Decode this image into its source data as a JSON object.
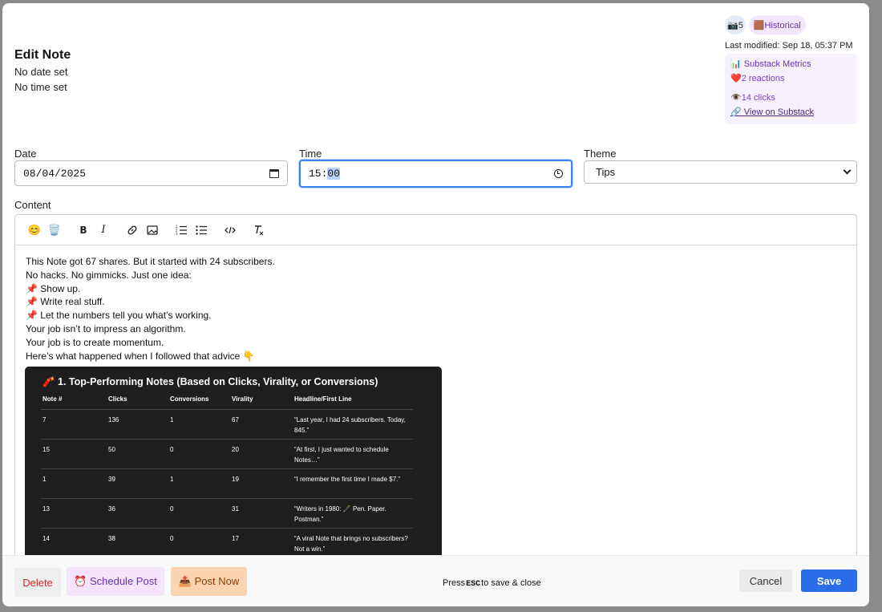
{
  "modal": {
    "title": "Edit Note",
    "date_status": "No date set",
    "time_status": "No time set"
  },
  "meta": {
    "image_badge": "📷5",
    "history_badge": "🟫Historical",
    "last_modified": "Last modified: Sep 18, 05:37 PM",
    "metrics_title": "📊 Substack Metrics",
    "reactions": "❤️2 reactions",
    "clicks": "👁️14 clicks",
    "view_link": "🔗 View on Substack"
  },
  "form": {
    "date_label": "Date",
    "date_value": "08/04/2025",
    "time_label": "Time",
    "time_hours": "15:",
    "time_minutes": "00",
    "theme_label": "Theme",
    "theme_value": "Tips"
  },
  "content": {
    "label": "Content",
    "toolbar": [
      "😊",
      "🗑️",
      "B",
      "I",
      "link",
      "image",
      "ordered-list",
      "bullet-list",
      "code",
      "clear-format"
    ],
    "lines": [
      "This Note got 67 shares. But it started with 24 subscribers.",
      "No hacks. No gimmicks. Just one idea:",
      " 📌 Show up.",
      " 📌 Write real stuff.",
      " 📌 Let the numbers tell you what’s working.",
      "Your job isn’t to impress an algorithm.",
      "Your job is to create momentum.",
      "Here’s what happened when I followed that advice 👇"
    ],
    "image": {
      "title": "🧨 1. Top-Performing Notes (Based on Clicks, Virality, or Conversions)",
      "columns": [
        "Note #",
        "Clicks",
        "Conversions",
        "Virality",
        "Headline/First Line"
      ],
      "rows": [
        [
          "7",
          "136",
          "1",
          "67",
          "“Last year, I had 24 subscribers. Today, 845.”"
        ],
        [
          "15",
          "50",
          "0",
          "20",
          "“At first, I just wanted to schedule Notes…”"
        ],
        [
          "1",
          "39",
          "1",
          "19",
          "“I remember the first time I made $7.”"
        ],
        [
          "13",
          "36",
          "0",
          "31",
          "“Writers in 1980: 🖋️ Pen. Paper. Postman.”"
        ],
        [
          "14",
          "38",
          "0",
          "17",
          "“A viral Note that brings no subscribers? Not a win.”"
        ]
      ]
    }
  },
  "footer": {
    "delete_label": "Delete",
    "schedule_label": "⏰ Schedule Post",
    "post_now_label": "📤 Post Now",
    "hint_prefix": "Press",
    "hint_key": "ESC",
    "hint_suffix": "to save & close",
    "cancel_label": "Cancel",
    "save_label": "Save"
  }
}
